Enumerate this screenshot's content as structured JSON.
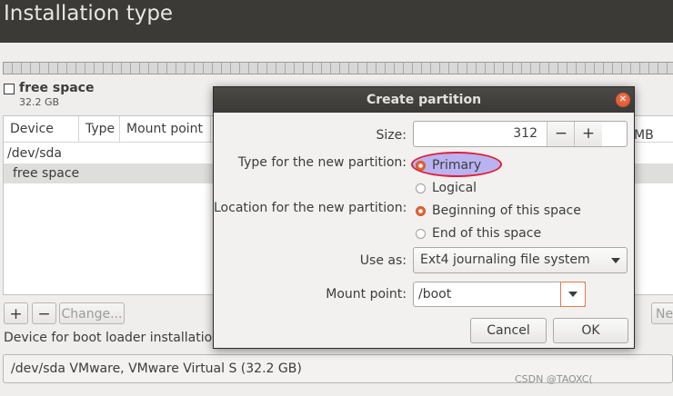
{
  "window": {
    "title": "Installation type"
  },
  "legend": {
    "name": "free space",
    "size": "32.2 GB"
  },
  "table": {
    "headers": [
      "Device",
      "Type",
      "Mount point"
    ],
    "rows": [
      "/dev/sda",
      "free space"
    ]
  },
  "toolbar": {
    "add_label": "+",
    "remove_label": "−",
    "change_label": "Change...",
    "new_table_label": "New"
  },
  "bootloader": {
    "label": "Device for boot loader installation:",
    "value": "/dev/sda VMware, VMware Virtual S (32.2 GB)"
  },
  "dialog": {
    "title": "Create partition",
    "close_icon": "close-icon",
    "size_label": "Size:",
    "size_value": "312",
    "size_minus": "−",
    "size_plus": "+",
    "size_unit": "MB",
    "type_label": "Type for the new partition:",
    "type_options": [
      "Primary",
      "Logical"
    ],
    "type_selected": "Primary",
    "location_label": "Location for the new partition:",
    "location_options": [
      "Beginning of this space",
      "End of this space"
    ],
    "location_selected": "Beginning of this space",
    "use_as_label": "Use as:",
    "use_as_value": "Ext4 journaling file system",
    "mount_label": "Mount point:",
    "mount_value": "/boot",
    "cancel_label": "Cancel",
    "ok_label": "OK"
  },
  "colors": {
    "accent": "#e26535",
    "highlight_fill": "#b9b3f2",
    "highlight_border": "#e41d35"
  },
  "watermark": "CSDN @TAOXC("
}
